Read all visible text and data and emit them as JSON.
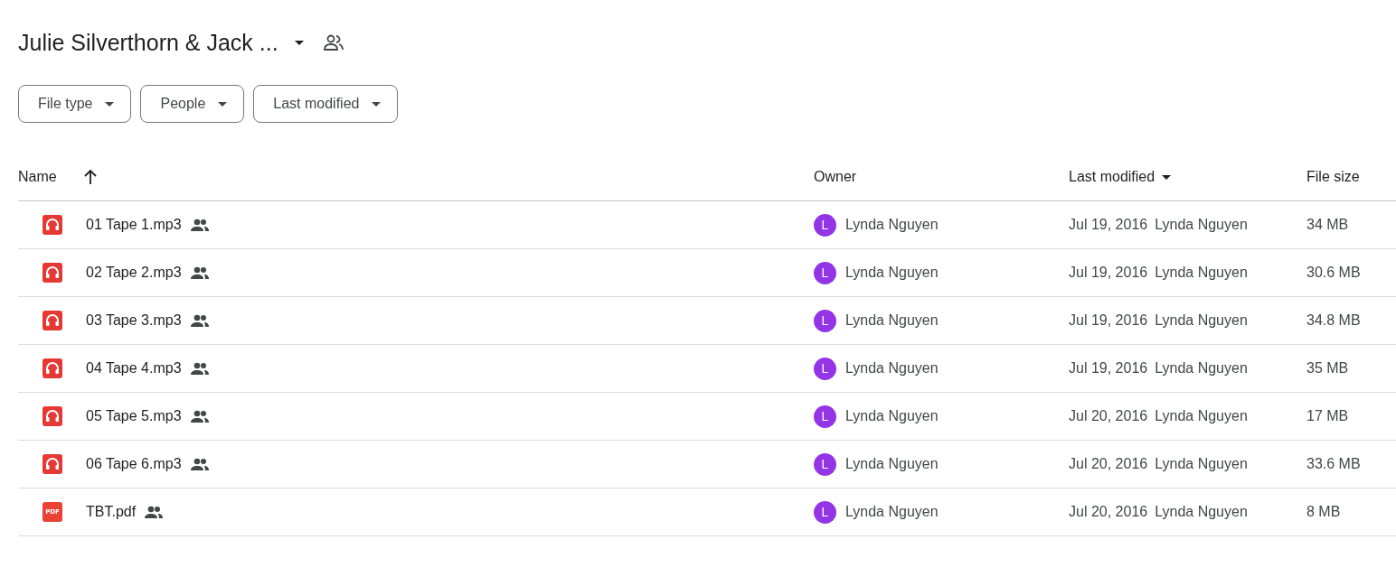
{
  "title": "Julie Silverthorn & Jack ...",
  "filters": [
    "File type",
    "People",
    "Last modified"
  ],
  "columns": {
    "name": "Name",
    "owner": "Owner",
    "modified": "Last modified",
    "size": "File size"
  },
  "rows": [
    {
      "kind": "audio",
      "name": "01 Tape 1.mp3",
      "avatar": "L",
      "owner": "Lynda Nguyen",
      "date": "Jul 19, 2016",
      "modified_by": "Lynda Nguyen",
      "size": "34 MB"
    },
    {
      "kind": "audio",
      "name": "02 Tape 2.mp3",
      "avatar": "L",
      "owner": "Lynda Nguyen",
      "date": "Jul 19, 2016",
      "modified_by": "Lynda Nguyen",
      "size": "30.6 MB"
    },
    {
      "kind": "audio",
      "name": "03 Tape 3.mp3",
      "avatar": "L",
      "owner": "Lynda Nguyen",
      "date": "Jul 19, 2016",
      "modified_by": "Lynda Nguyen",
      "size": "34.8 MB"
    },
    {
      "kind": "audio",
      "name": "04 Tape 4.mp3",
      "avatar": "L",
      "owner": "Lynda Nguyen",
      "date": "Jul 19, 2016",
      "modified_by": "Lynda Nguyen",
      "size": "35 MB"
    },
    {
      "kind": "audio",
      "name": "05 Tape 5.mp3",
      "avatar": "L",
      "owner": "Lynda Nguyen",
      "date": "Jul 20, 2016",
      "modified_by": "Lynda Nguyen",
      "size": "17 MB"
    },
    {
      "kind": "audio",
      "name": "06 Tape 6.mp3",
      "avatar": "L",
      "owner": "Lynda Nguyen",
      "date": "Jul 20, 2016",
      "modified_by": "Lynda Nguyen",
      "size": "33.6 MB"
    },
    {
      "kind": "pdf",
      "icon_label": "PDF",
      "name": "TBT.pdf",
      "avatar": "L",
      "owner": "Lynda Nguyen",
      "date": "Jul 20, 2016",
      "modified_by": "Lynda Nguyen",
      "size": "8 MB"
    }
  ]
}
